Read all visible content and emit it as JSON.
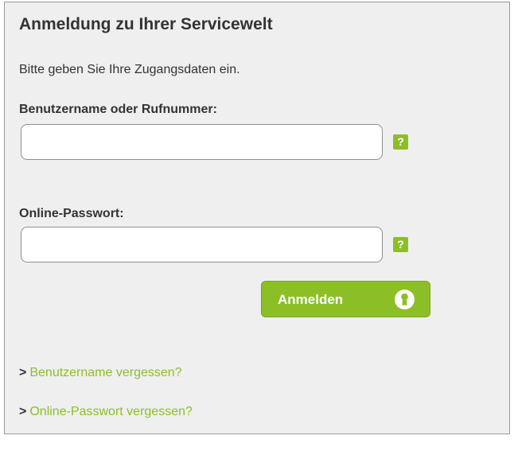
{
  "login": {
    "title": "Anmeldung zu Ihrer Servicewelt",
    "intro": "Bitte geben Sie Ihre Zugangsdaten ein.",
    "username": {
      "label": "Benutzername oder Rufnummer:",
      "value": "",
      "help": "?"
    },
    "password": {
      "label": "Online-Passwort:",
      "value": "",
      "help": "?"
    },
    "submit": {
      "label": "Anmelden",
      "icon": "keyhole-icon"
    },
    "links": [
      {
        "arrow": ">",
        "label": "Benutzername vergessen?"
      },
      {
        "arrow": ">",
        "label": "Online-Passwort vergessen?"
      }
    ]
  },
  "colors": {
    "accent": "#8cbf26",
    "panel_background": "#efefef",
    "panel_border": "#9a9a9a",
    "text": "#333333"
  }
}
